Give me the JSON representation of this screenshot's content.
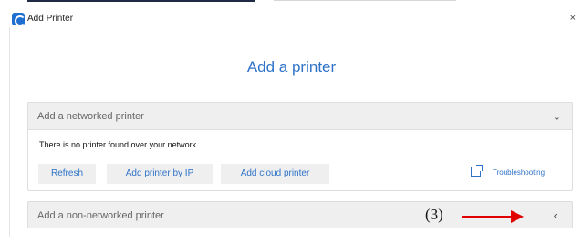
{
  "window": {
    "title": "Add Printer",
    "close": "×"
  },
  "heading": "Add a printer",
  "networked": {
    "title": "Add a networked printer",
    "chevron": "⌄",
    "status": "There is no printer found over your network.",
    "buttons": {
      "refresh": "Refresh",
      "by_ip": "Add printer by IP",
      "cloud": "Add cloud printer"
    },
    "troubleshooting": "Troubleshooting"
  },
  "non_networked": {
    "title": "Add a non-networked printer",
    "chevron": "‹"
  },
  "annotation": {
    "label": "(3)"
  },
  "colors": {
    "accent": "#2f73c8",
    "annotation_arrow": "#e00000",
    "panel_bg": "#efefef"
  },
  "icons": [
    "app-icon",
    "close-icon",
    "chevron-down-icon",
    "external-link-icon",
    "chevron-left-icon",
    "arrow-icon"
  ]
}
